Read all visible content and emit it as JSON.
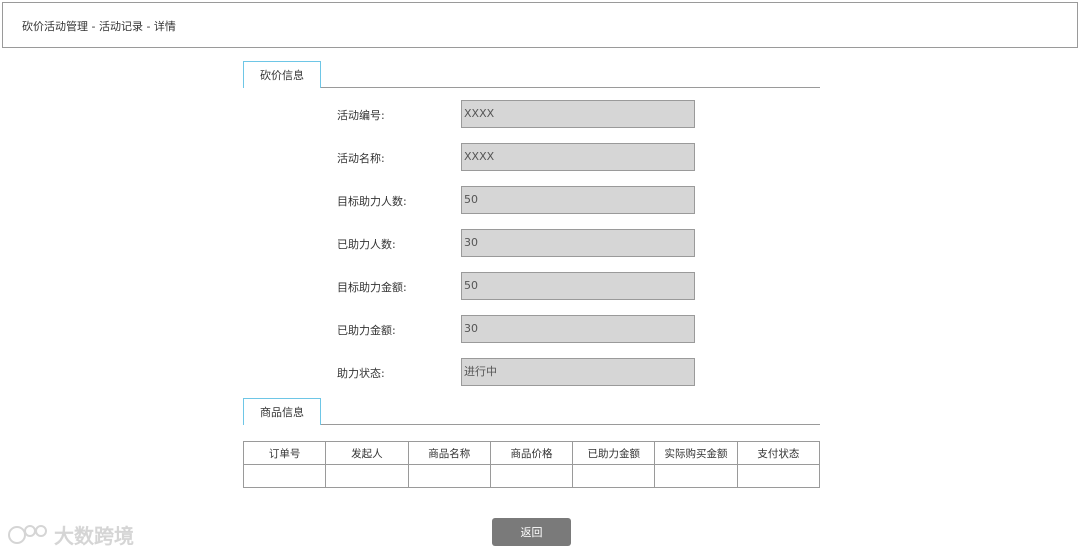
{
  "breadcrumb": "砍价活动管理 - 活动记录 - 详情",
  "sections": {
    "bargain_info": "砍价信息",
    "product_info": "商品信息"
  },
  "form": [
    {
      "label": "活动编号:",
      "value": "XXXX"
    },
    {
      "label": "活动名称:",
      "value": "XXXX"
    },
    {
      "label": "目标助力人数:",
      "value": "50"
    },
    {
      "label": "已助力人数:",
      "value": "30"
    },
    {
      "label": "目标助力金额:",
      "value": "50"
    },
    {
      "label": "已助力金额:",
      "value": "30"
    },
    {
      "label": "助力状态:",
      "value": "进行中"
    }
  ],
  "table": {
    "headers": [
      "订单号",
      "发起人",
      "商品名称",
      "商品价格",
      "已助力金额",
      "实际购买金额",
      "支付状态"
    ]
  },
  "buttons": {
    "back": "返回"
  },
  "watermark": "大数跨境"
}
